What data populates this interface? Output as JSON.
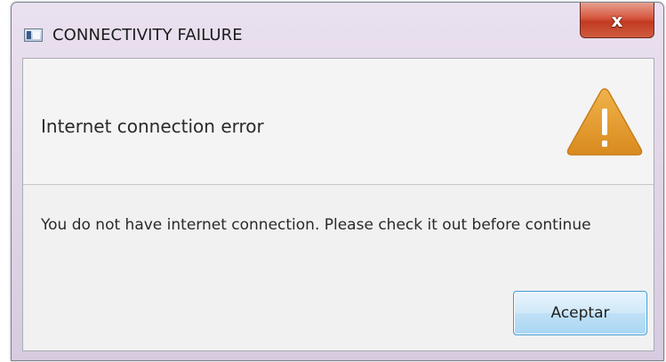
{
  "window": {
    "title": "CONNECTIVITY FAILURE",
    "icon": "window-app-icon",
    "close_glyph": "x"
  },
  "dialog": {
    "header_text": "Internet connection error",
    "header_icon": "warning-icon",
    "content_text": "You do not have internet connection. Please check it out before continue",
    "button_label": "Aceptar"
  },
  "colors": {
    "warning_fill": "#e09a2a",
    "close_button": "#c94a33",
    "accept_border": "#3c9ad6"
  }
}
